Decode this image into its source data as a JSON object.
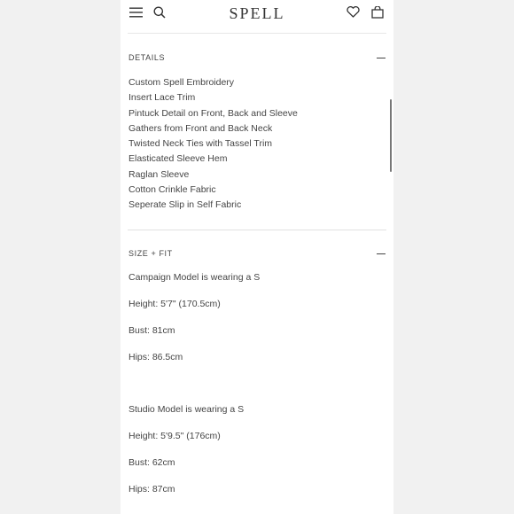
{
  "header": {
    "brand": "SPELL",
    "icons": [
      "menu-icon",
      "search-icon",
      "heart-icon",
      "bag-icon"
    ]
  },
  "details": {
    "title": "DETAILS",
    "items": [
      "Custom Spell Embroidery",
      "Insert Lace Trim",
      "Pintuck Detail on Front, Back and Sleeve",
      "Gathers from Front and Back Neck",
      "Twisted Neck Ties with Tassel Trim",
      "Elasticated Sleeve Hem",
      "Raglan Sleeve",
      "Cotton Crinkle Fabric",
      "Seperate Slip in Self Fabric"
    ]
  },
  "size_fit": {
    "title": "SIZE + FIT",
    "campaign": {
      "intro": "Campaign Model is wearing a S",
      "height": "Height: 5'7\" (170.5cm)",
      "bust": "Bust: 81cm",
      "hips": "Hips: 86.5cm"
    },
    "studio": {
      "intro": "Studio Model is wearing a S",
      "height": "Height: 5'9.5\" (176cm)",
      "bust": "Bust: 62cm",
      "hips": "Hips: 87cm"
    }
  }
}
